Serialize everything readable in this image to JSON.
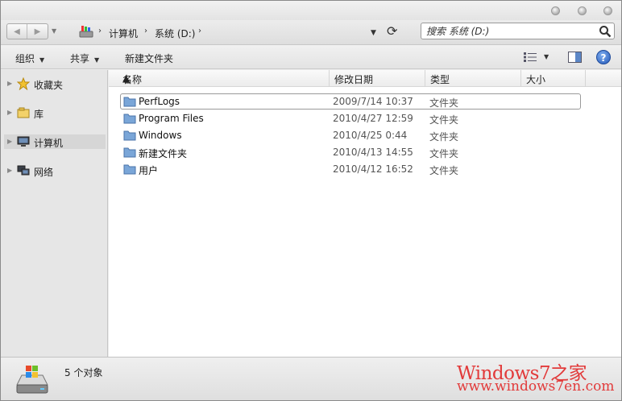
{
  "search": {
    "placeholder": "搜索 系统 (D:)"
  },
  "address": {
    "crumbs": [
      "计算机",
      "系统 (D:)"
    ]
  },
  "toolbar": {
    "organize": "组织",
    "share": "共享",
    "new_folder": "新建文件夹"
  },
  "nav": {
    "favorites": "收藏夹",
    "libraries": "库",
    "computer": "计算机",
    "network": "网络"
  },
  "columns": {
    "name": "名称",
    "date": "修改日期",
    "type": "类型",
    "size": "大小"
  },
  "files": [
    {
      "name": "PerfLogs",
      "date": "2009/7/14 10:37",
      "type": "文件夹"
    },
    {
      "name": "Program Files",
      "date": "2010/4/27 12:59",
      "type": "文件夹"
    },
    {
      "name": "Windows",
      "date": "2010/4/25 0:44",
      "type": "文件夹"
    },
    {
      "name": "新建文件夹",
      "date": "2010/4/13 14:55",
      "type": "文件夹"
    },
    {
      "name": "用户",
      "date": "2010/4/12 16:52",
      "type": "文件夹"
    }
  ],
  "status": {
    "item_count": "5 个对象"
  },
  "watermark": {
    "line1": "Windows7之家",
    "line2": "www.windows7en.com"
  },
  "colors": {
    "accent": "#2458b8",
    "folder": "#7aa6d8",
    "watermark": "#e23a3a"
  }
}
